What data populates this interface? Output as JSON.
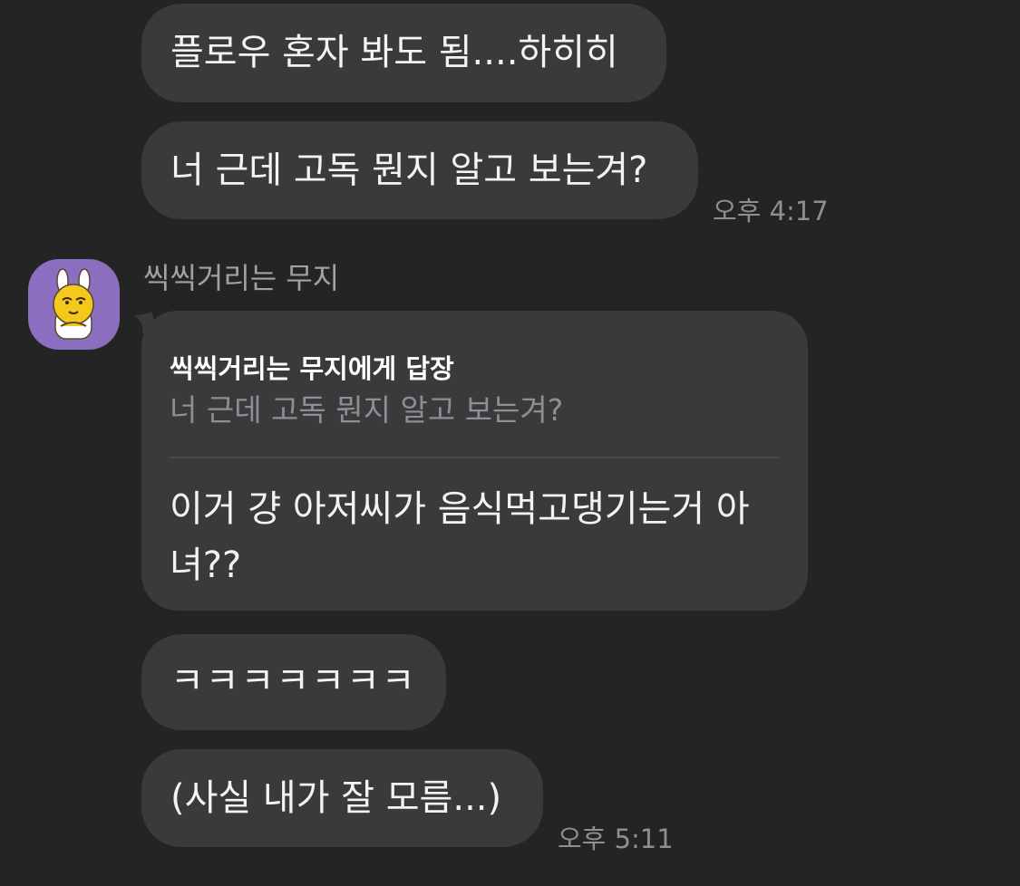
{
  "messages": {
    "m1": {
      "text": "플로우 혼자 봐도 됨....하히히"
    },
    "m2": {
      "text": "너 근데 고독 뭔지 알고 보는겨?",
      "time": "오후 4:17"
    },
    "sender_name": "씩씩거리는 무지",
    "avatar_character": "yellow rabbit-eared character",
    "reply": {
      "title": "씩씩거리는 무지에게 답장",
      "quoted": "너 근데 고독 뭔지 알고 보는겨?",
      "body_line1": "이거 걍 아저씨가 음식먹고댕기는거 아",
      "body_line2": "녀??"
    },
    "m4": {
      "text": "ㅋㅋㅋㅋㅋㅋㅋ"
    },
    "m5": {
      "text": "(사실 내가 잘 모름...)",
      "time": "오후 5:11"
    }
  },
  "colors": {
    "background": "#242424",
    "bubble": "#3a3a3c",
    "text": "#f3f3f3",
    "muted": "#8e8e93",
    "avatar_bg": "#8a6fc0"
  }
}
